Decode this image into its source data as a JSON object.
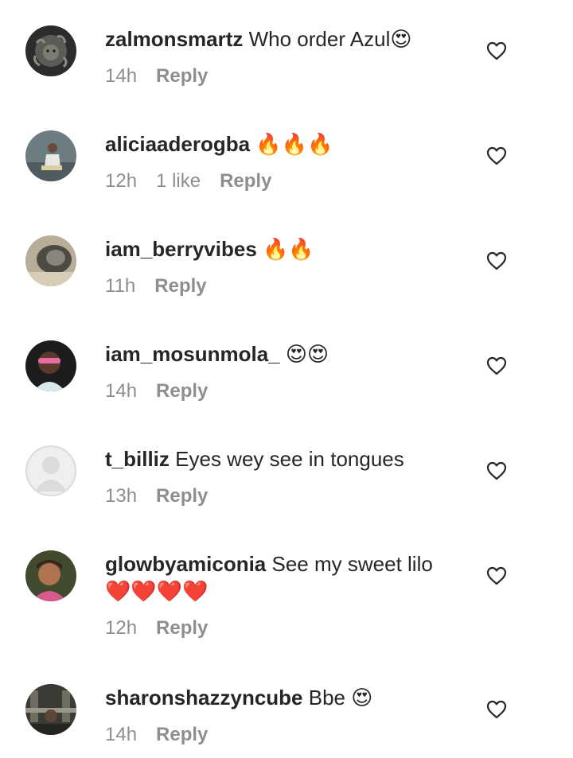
{
  "comments": [
    {
      "username": "zalmonsmartz",
      "text": "Who order Azul",
      "emoji": "😍",
      "time": "14h",
      "likes": "",
      "reply": "Reply",
      "avatar": "medusa-avatar"
    },
    {
      "username": "aliciaaderogba",
      "text": "",
      "emoji": "🔥🔥🔥",
      "time": "12h",
      "likes": "1 like",
      "reply": "Reply",
      "avatar": "person-photo-avatar"
    },
    {
      "username": "iam_berryvibes",
      "text": "",
      "emoji": "🔥🔥",
      "time": "11h",
      "likes": "",
      "reply": "Reply",
      "avatar": "car-photo-avatar"
    },
    {
      "username": "iam_mosunmola_",
      "text": "",
      "emoji": "😍😍",
      "time": "14h",
      "likes": "",
      "reply": "Reply",
      "avatar": "person-sunglasses-avatar"
    },
    {
      "username": "t_billiz",
      "text": "Eyes wey see in tongues",
      "emoji": "",
      "time": "13h",
      "likes": "",
      "reply": "Reply",
      "avatar": "default-avatar"
    },
    {
      "username": "glowbyamiconia",
      "text": "See my sweet lilo",
      "emoji": "❤️❤️❤️❤️",
      "time": "12h",
      "likes": "",
      "reply": "Reply",
      "avatar": "person-selfie-avatar"
    },
    {
      "username": "sharonshazzyncube",
      "text": "Bbe",
      "emoji": "😍",
      "time": "14h",
      "likes": "",
      "reply": "Reply",
      "avatar": "gym-photo-avatar"
    }
  ],
  "colors": {
    "text": "#262626",
    "meta": "#8e8e8e",
    "background": "#ffffff"
  }
}
